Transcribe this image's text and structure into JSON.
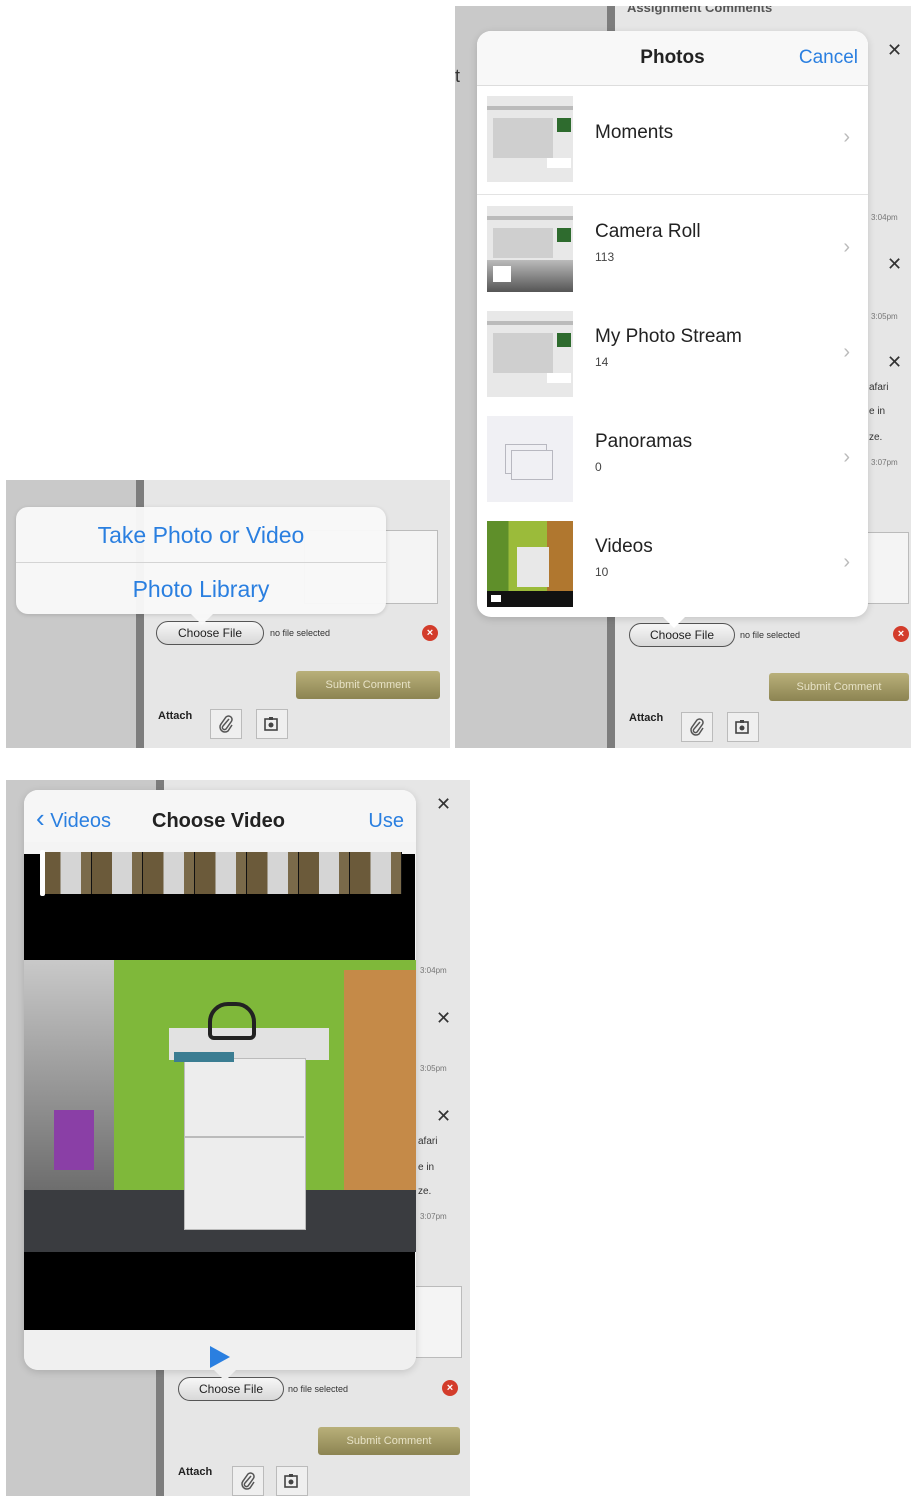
{
  "panel1": {
    "sheet": {
      "take_photo": "Take Photo or Video",
      "photo_library": "Photo Library"
    },
    "choose_file": "Choose File",
    "no_file": "no file selected",
    "submit": "Submit Comment",
    "attach": "Attach"
  },
  "panel2": {
    "header_partial": "Assignment Comments",
    "popover": {
      "title": "Photos",
      "cancel": "Cancel"
    },
    "albums": [
      {
        "name": "Moments",
        "count": ""
      },
      {
        "name": "Camera Roll",
        "count": "113"
      },
      {
        "name": "My Photo Stream",
        "count": "14"
      },
      {
        "name": "Panoramas",
        "count": "0"
      },
      {
        "name": "Videos",
        "count": "10"
      }
    ],
    "side": {
      "time1": "3:04pm",
      "time2": "3:05pm",
      "time3": "3:07pm",
      "text1": "afari",
      "text2": "e in",
      "text3": "ze."
    },
    "choose_file": "Choose File",
    "no_file": "no file selected",
    "submit": "Submit Comment",
    "attach": "Attach"
  },
  "panel3": {
    "back": "Videos",
    "title": "Choose Video",
    "use": "Use",
    "side": {
      "time1": "3:04pm",
      "time2": "3:05pm",
      "time3": "3:07pm",
      "text1": "afari",
      "text2": "e in",
      "text3": "ze."
    },
    "choose_file": "Choose File",
    "no_file": "no file selected",
    "submit": "Submit Comment",
    "attach": "Attach"
  },
  "colors": {
    "accent": "#2a7fe0",
    "submit": "#9f9764",
    "delete": "#d33c2b"
  },
  "icons": {
    "close": "close-icon",
    "paperclip": "paperclip-icon",
    "camera": "camera-icon",
    "chevron": "chevron-right-icon",
    "play": "play-icon"
  }
}
